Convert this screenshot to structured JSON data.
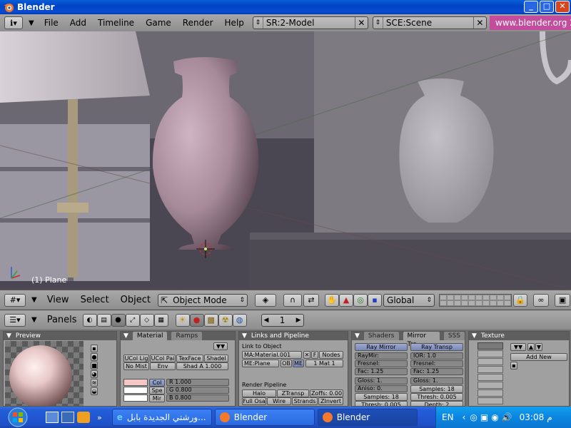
{
  "window": {
    "title": "Blender"
  },
  "top_menu": {
    "items": [
      "File",
      "Add",
      "Timeline",
      "Game",
      "Render",
      "Help"
    ],
    "screen_field": "SR:2-Model",
    "scene_field": "SCE:Scene",
    "website": "www.blender.org 2"
  },
  "viewport": {
    "object_label": "(1) Plane"
  },
  "view3d_header": {
    "menus": [
      "View",
      "Select",
      "Object"
    ],
    "mode": "Object Mode",
    "orientation": "Global"
  },
  "buttons_header": {
    "panels_label": "Panels",
    "frame": "1"
  },
  "panels": {
    "preview": {
      "title": "Preview"
    },
    "material": {
      "tabs": [
        "Material",
        "Ramps"
      ],
      "buttons": [
        "UCol Lig",
        "UCol Pai",
        "TexFace",
        "Shadel",
        "No Mist",
        "Env",
        "Shad A 1.000"
      ],
      "color_labels": [
        "Col",
        "Spe",
        "Mir"
      ],
      "rgb": [
        "R 1.000",
        "G 0.800",
        "B 0.800"
      ]
    },
    "links": {
      "title": "Links and Pipeline",
      "link_to_object": "Link to Object",
      "material_name": "MA:Material.001",
      "f_label": "F",
      "nodes": "Nodes",
      "mesh": "ME:Plane",
      "ob": "OB",
      "me": "ME",
      "mat_count": "1 Mat 1",
      "render_pipeline": "Render Pipeline",
      "pipeline_buttons": [
        "Halo",
        "ZTransp",
        "Zoffs: 0.00",
        "Full Osa",
        "Wire",
        "Strands",
        "ZInvert"
      ]
    },
    "shaders": {
      "tabs": [
        "Shaders",
        "Mirror Tra",
        "SSS"
      ],
      "ray_mirror": "Ray Mirror",
      "ray_transp": "Ray Transp",
      "left_fields": [
        "RayMir:",
        "Fresnel:",
        "Fac: 1.25",
        "Gloss: 1.",
        "Aniso: 0.",
        "Samples: 18",
        "Thresh: 0.005"
      ],
      "right_fields": [
        "IOR: 1.0",
        "Fresnel:",
        "Fac: 1.25",
        "Gloss: 1.",
        "Samples: 18",
        "Thresh: 0.005",
        "Depth: 2"
      ]
    },
    "texture": {
      "title": "Texture",
      "add_new": "Add New"
    }
  },
  "taskbar": {
    "tasks": [
      "ورشتي الجديدة بابل...",
      "Blender",
      "Blender"
    ],
    "lang": "EN",
    "clock": "03:08",
    "ampm": "م"
  },
  "colors": {
    "blender_header": "#a0a0a0",
    "xp_blue": "#245edb",
    "vase": "#a68a9a"
  }
}
